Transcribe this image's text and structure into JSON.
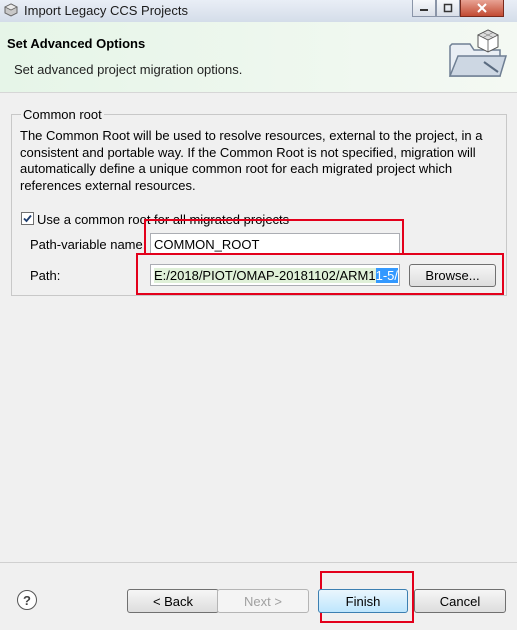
{
  "window": {
    "title": "Import Legacy CCS Projects",
    "caption_buttons": [
      "minimize",
      "maximize",
      "close"
    ]
  },
  "banner": {
    "title": "Set Advanced Options",
    "subtitle": "Set advanced project migration options."
  },
  "group": {
    "title": "Common root",
    "description": "The Common Root will be used to resolve resources, external to the project, in a consistent and portable way. If the Common Root is not specified, migration will automatically define a unique common root for each migrated project which references external resources.",
    "checkbox_label": "Use a common root for all migrated projects",
    "checkbox_checked": true,
    "path_variable_label": "Path-variable name:",
    "path_variable_value": "COMMON_ROOT",
    "path_label": "Path:",
    "path_value_main": "E:/2018/PIOT/OMAP-20181102/ARM1",
    "path_value_selected": "1-5/",
    "browse_label": "Browse..."
  },
  "footer": {
    "help_icon": "help-icon",
    "back_label": "< Back",
    "next_label": "Next >",
    "finish_label": "Finish",
    "cancel_label": "Cancel"
  },
  "colors": {
    "highlight_red": "#e3001b",
    "selection_blue": "#3399ff",
    "banner_green": "#e6f5e8"
  }
}
